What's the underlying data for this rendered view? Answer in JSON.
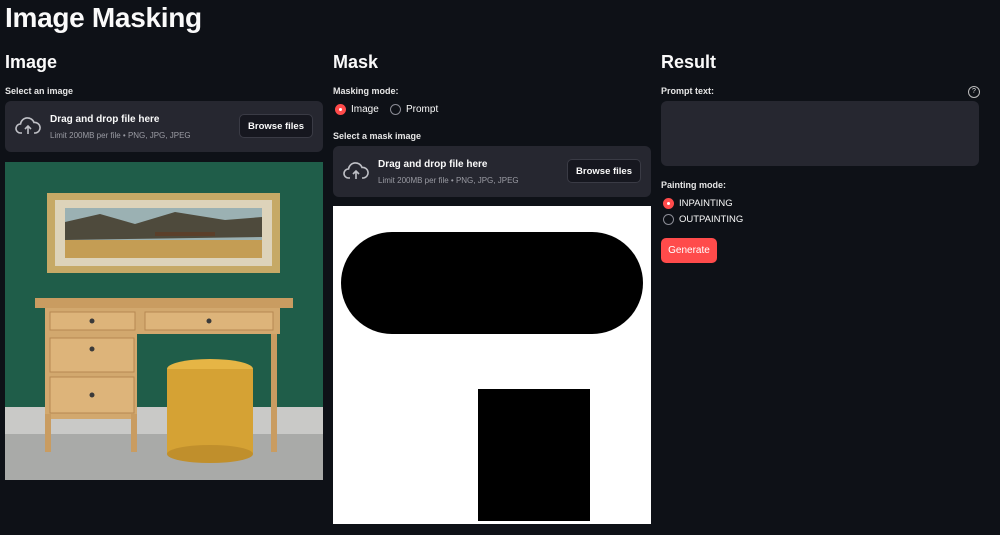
{
  "page": {
    "title": "Image Masking"
  },
  "image_col": {
    "heading": "Image",
    "select_label": "Select an image",
    "uploader": {
      "title": "Drag and drop file here",
      "limit": "Limit 200MB per file • PNG, JPG, JPEG",
      "button": "Browse files"
    },
    "preview_alt": "Room with wooden desk, yellow ottoman and framed landscape painting on green wall"
  },
  "mask_col": {
    "heading": "Mask",
    "mode_label": "Masking mode:",
    "modes": [
      {
        "label": "Image",
        "selected": true
      },
      {
        "label": "Prompt",
        "selected": false
      }
    ],
    "select_label": "Select a mask image",
    "uploader": {
      "title": "Drag and drop file here",
      "limit": "Limit 200MB per file • PNG, JPG, JPEG",
      "button": "Browse files"
    }
  },
  "result_col": {
    "heading": "Result",
    "prompt_label": "Prompt text:",
    "prompt_value": "",
    "help_icon": "question-circle-icon",
    "painting_label": "Painting mode:",
    "painting_modes": [
      {
        "label": "INPAINTING",
        "selected": true
      },
      {
        "label": "OUTPAINTING",
        "selected": false
      }
    ],
    "generate_button": "Generate"
  },
  "colors": {
    "accent": "#ff4b4b",
    "background": "#0e1117",
    "widget_bg": "#262730"
  }
}
